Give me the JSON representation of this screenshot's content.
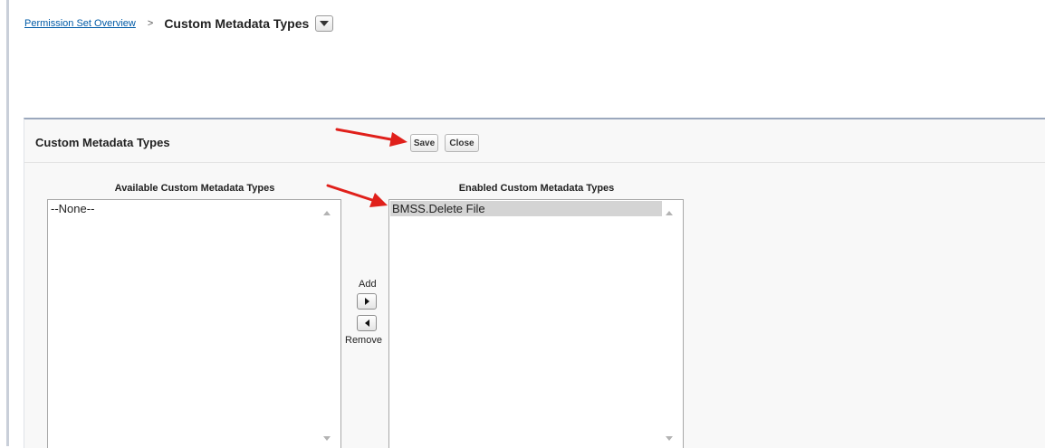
{
  "breadcrumb": {
    "parent_link": "Permission Set Overview",
    "separator": ">",
    "current": "Custom Metadata Types"
  },
  "panel": {
    "title": "Custom Metadata Types",
    "save_label": "Save",
    "close_label": "Close"
  },
  "available": {
    "label": "Available Custom Metadata Types",
    "options": [
      "--None--"
    ]
  },
  "enabled": {
    "label": "Enabled Custom Metadata Types",
    "options": [
      "BMSS.Delete File"
    ]
  },
  "mover": {
    "add_label": "Add",
    "remove_label": "Remove"
  },
  "icons": {
    "menu": "chevron-down-icon",
    "add": "arrow-right-icon",
    "remove": "arrow-left-icon"
  },
  "colors": {
    "link": "#015ba7",
    "panel_border": "#9ba8bd",
    "selected_option": "#d4d4d4",
    "annotation_arrow": "#e0201b"
  }
}
